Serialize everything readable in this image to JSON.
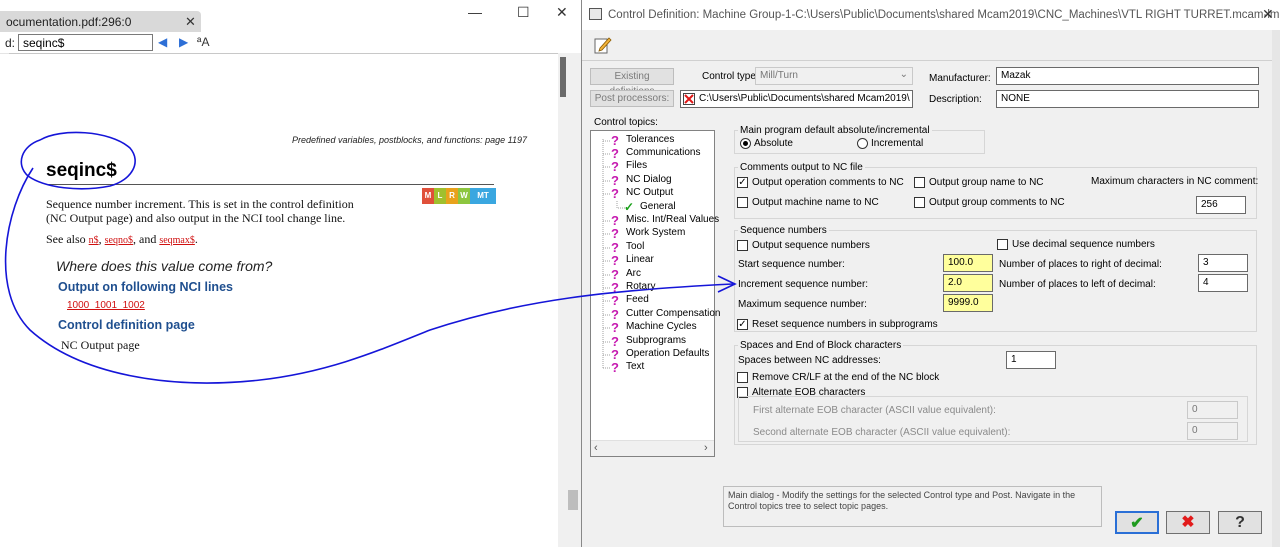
{
  "pdf": {
    "tab_title": "ocumentation.pdf:296:0",
    "tab_close": "✕",
    "win_min": "—",
    "win_max": "☐",
    "win_close": "✕",
    "find_label": "d:",
    "find_value": "seqinc$",
    "find_prev": "◀",
    "find_next": "▶",
    "find_options": "ªA",
    "page_footer": "Predefined variables, postblocks, and functions: page 1197",
    "keyword_title": "seqinc$",
    "badges": [
      "M",
      "L",
      "R",
      "W",
      "MT"
    ],
    "description": "Sequence number increment. This is set in the control definition (NC Output page) and also output in the NCI tool change line.",
    "see_also_prefix": "See also ",
    "see_also_links": [
      "n$",
      "seqno$",
      "seqmax$"
    ],
    "see_also_sep1": ", ",
    "see_also_sep2": ", and ",
    "see_also_end": ".",
    "where_heading": "Where does this value come from?",
    "output_heading": "Output on following NCI lines",
    "output_lines": "1000  1001  1002",
    "ctrl_heading": "Control definition page",
    "ctrl_value": "NC Output page"
  },
  "dialog": {
    "title": "Control Definition: Machine Group-1-C:\\Users\\Public\\Documents\\shared Mcam2019\\CNC_Machines\\VTL RIGHT TURRET.mcam-lmd",
    "close": "✕",
    "existing_definitions": "Existing definitions",
    "post_processors": "Post processors:",
    "control_type_label": "Control type:",
    "control_type_value": "Mill/Turn",
    "post_path": "C:\\Users\\Public\\Documents\\shared Mcam2019\\",
    "manufacturer_label": "Manufacturer:",
    "manufacturer_value": "Mazak",
    "description_label": "Description:",
    "description_value": "NONE",
    "control_topics_label": "Control topics:",
    "topics": [
      {
        "label": "Tolerances",
        "icon": "question-icon"
      },
      {
        "label": "Communications",
        "icon": "question-icon"
      },
      {
        "label": "Files",
        "icon": "question-icon"
      },
      {
        "label": "NC Dialog",
        "icon": "question-icon"
      },
      {
        "label": "NC Output",
        "icon": "question-icon"
      },
      {
        "label": "General",
        "icon": "check-icon"
      },
      {
        "label": "Misc. Int/Real Values",
        "icon": "question-icon"
      },
      {
        "label": "Work System",
        "icon": "question-icon"
      },
      {
        "label": "Tool",
        "icon": "question-icon"
      },
      {
        "label": "Linear",
        "icon": "question-icon"
      },
      {
        "label": "Arc",
        "icon": "question-icon"
      },
      {
        "label": "Rotary",
        "icon": "question-icon"
      },
      {
        "label": "Feed",
        "icon": "question-icon"
      },
      {
        "label": "Cutter Compensation",
        "icon": "question-icon"
      },
      {
        "label": "Machine Cycles",
        "icon": "question-icon"
      },
      {
        "label": "Subprograms",
        "icon": "question-icon"
      },
      {
        "label": "Operation Defaults",
        "icon": "question-icon"
      },
      {
        "label": "Text",
        "icon": "question-icon"
      }
    ],
    "main_program": {
      "title": "Main program default absolute/incremental",
      "absolute": "Absolute",
      "incremental": "Incremental",
      "selected": "Absolute"
    },
    "comments": {
      "title": "Comments output to NC file",
      "op_comments": "Output operation comments to NC",
      "group_name": "Output group name to NC",
      "max_chars_label": "Maximum characters in NC comment:",
      "machine_name": "Output machine name to NC",
      "group_comments": "Output group comments to NC",
      "max_chars_value": "256"
    },
    "sequence": {
      "title": "Sequence numbers",
      "output_seq": "Output sequence numbers",
      "use_decimal": "Use decimal sequence numbers",
      "start_label": "Start sequence number:",
      "start_value": "100.0",
      "right_label": "Number of places to right of decimal:",
      "right_value": "3",
      "incr_label": "Increment sequence number:",
      "incr_value": "2.0",
      "left_label": "Number of places to left of decimal:",
      "left_value": "4",
      "max_label": "Maximum sequence number:",
      "max_value": "9999.0",
      "reset": "Reset sequence numbers in subprograms"
    },
    "spaces": {
      "title": "Spaces and End of Block characters",
      "spaces_label": "Spaces between NC addresses:",
      "spaces_value": "1",
      "remove_crlf": "Remove CR/LF at the end of the NC block",
      "alt_eob": "Alternate EOB characters",
      "first_label": "First alternate EOB character (ASCII value equivalent):",
      "first_value": "0",
      "second_label": "Second alternate EOB character (ASCII value equivalent):",
      "second_value": "0"
    },
    "help_text": "Main dialog - Modify the settings for the selected Control type and Post.  Navigate in the Control topics tree to select topic pages.",
    "ok_glyph": "✔",
    "cancel_glyph": "✖",
    "help_glyph": "?",
    "checkmark": "✓",
    "scroll_left": "‹",
    "scroll_right": "›"
  },
  "colors": {
    "link_blue": "#1f4f8f",
    "link_red": "#d01010",
    "annotation_blue": "#1515d8",
    "highlight_yellow": "#ffff9c",
    "topic_magenta": "#c61ab0",
    "check_green": "#18a018",
    "badge_colors": [
      "#e0503a",
      "#a0c02e",
      "#e8a21c",
      "#8dc63f",
      "#3aa7e0"
    ]
  }
}
